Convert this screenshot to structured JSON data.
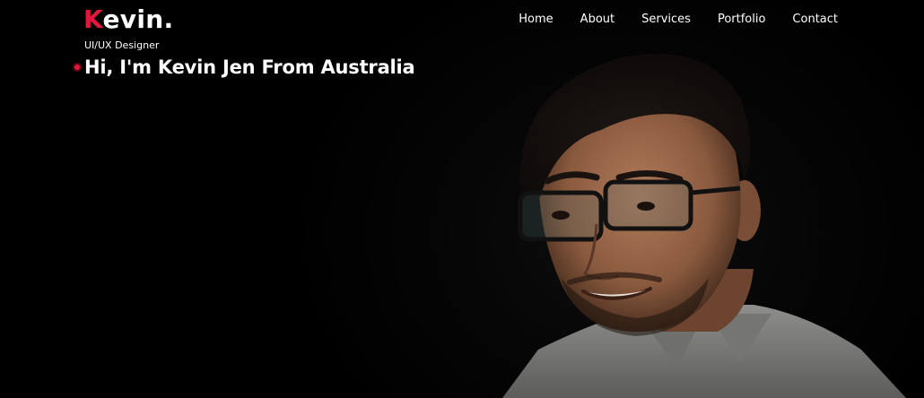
{
  "brand": {
    "logo_initial": "K",
    "logo_rest": "evin.",
    "tagline": "UI/UX Designer",
    "accent_color": "#e3163d"
  },
  "nav": {
    "items": [
      {
        "label": "Home"
      },
      {
        "label": "About"
      },
      {
        "label": "Services"
      },
      {
        "label": "Portfolio"
      },
      {
        "label": "Contact"
      }
    ]
  },
  "hero": {
    "headline": "Hi, I'm Kevin Jen From Australia",
    "bullet_icon": "record-dot-icon",
    "portrait": "man-with-glasses-portrait"
  }
}
